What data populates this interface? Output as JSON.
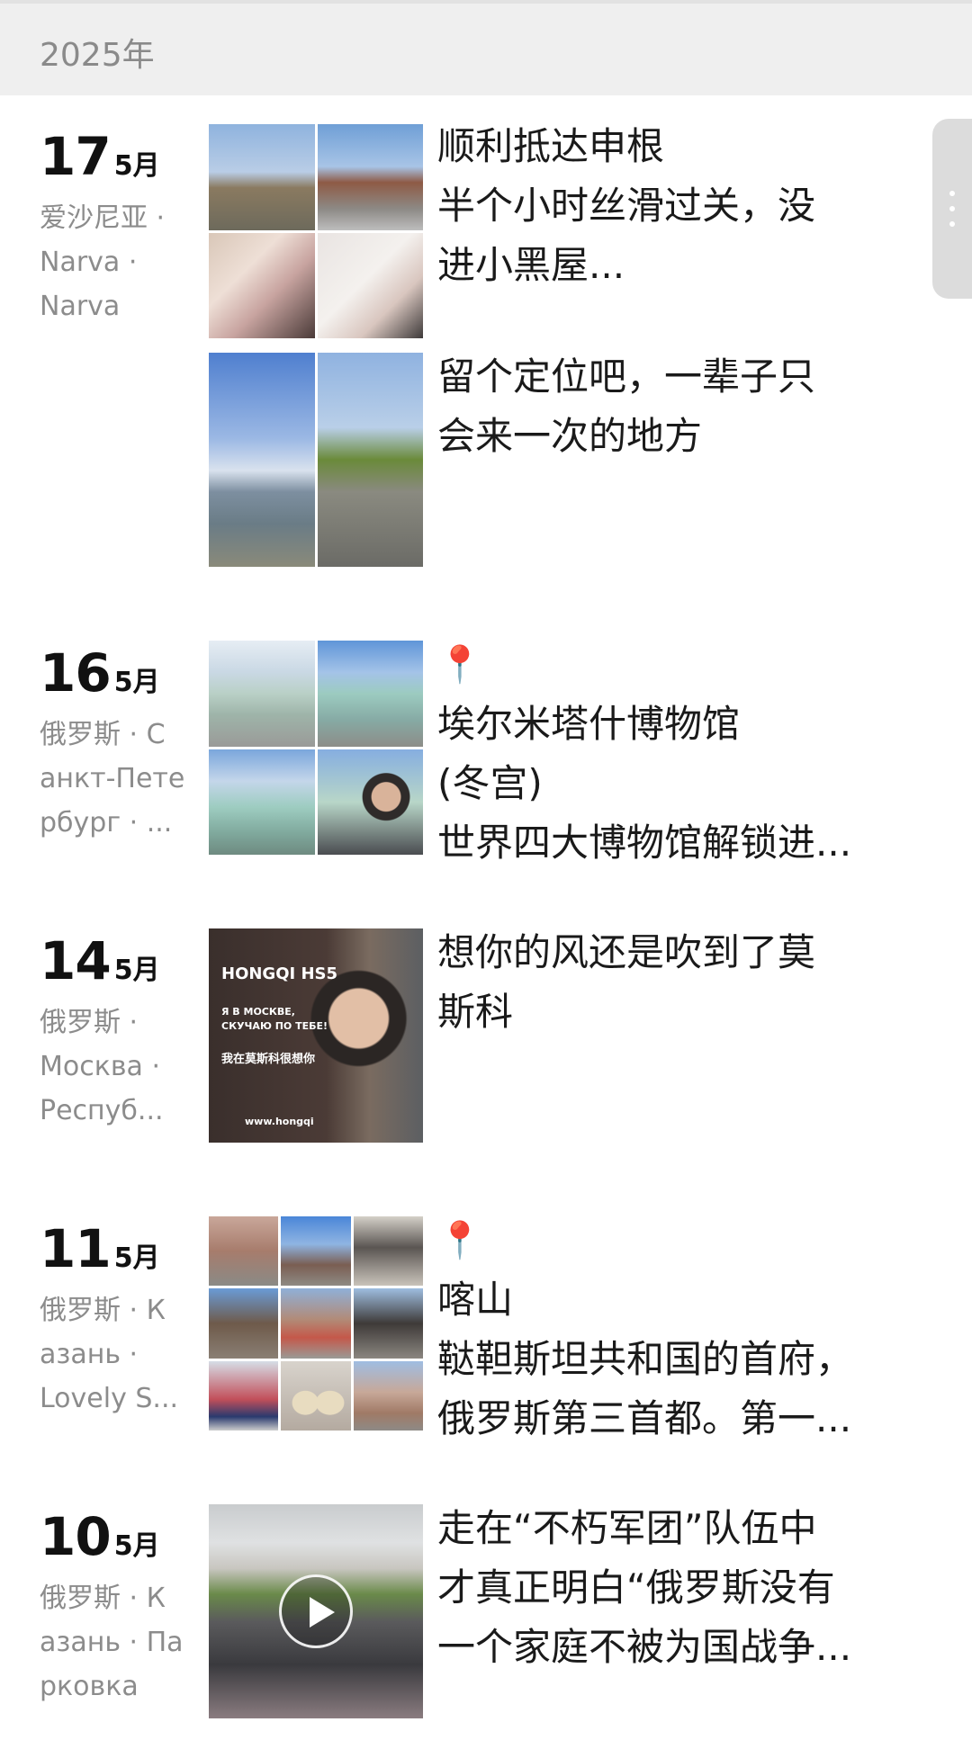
{
  "year_header": "2025年",
  "entries": [
    {
      "day": "17",
      "month": "5月",
      "location_lines": [
        "爱沙尼亚 ·",
        "Narva ·",
        "Narva"
      ],
      "posts": [
        {
          "caption_lines": [
            "顺利抵达申根",
            "半个小时丝滑过关，没",
            "进小黑屋..."
          ],
          "pin": false
        },
        {
          "caption_lines": [
            "留个定位吧，一辈子只",
            "会来一次的地方"
          ],
          "pin": false
        }
      ]
    },
    {
      "day": "16",
      "month": "5月",
      "location_lines": [
        "俄罗斯 · С",
        "анкт-Пете",
        "рбург · ..."
      ],
      "posts": [
        {
          "caption_lines": [
            "埃尔米塔什博物馆",
            "(冬宫)",
            "世界四大博物馆解锁进..."
          ],
          "pin": true
        }
      ]
    },
    {
      "day": "14",
      "month": "5月",
      "location_lines": [
        "俄罗斯 ·",
        "Москва ·",
        "Респуб..."
      ],
      "posts": [
        {
          "caption_lines": [
            "想你的风还是吹到了莫",
            "斯科"
          ],
          "pin": false,
          "photo_text": [
            "HONGQI HS5",
            "Я В МОСКВЕ,",
            "СКУЧАЮ ПО ТЕБЕ!",
            "我在莫斯科很想你",
            "www.hongqi"
          ]
        }
      ]
    },
    {
      "day": "11",
      "month": "5月",
      "location_lines": [
        "俄罗斯 · К",
        "азань ·",
        "Lovely S..."
      ],
      "posts": [
        {
          "caption_lines": [
            "喀山",
            "鞑靼斯坦共和国的首府，",
            "俄罗斯第三首都。第一..."
          ],
          "pin": true
        }
      ]
    },
    {
      "day": "10",
      "month": "5月",
      "location_lines": [
        "俄罗斯 · К",
        "азань · Па",
        "рковка"
      ],
      "posts": [
        {
          "caption_lines": [
            "走在“不朽军团”队伍中",
            "才真正明白“俄罗斯没有",
            "一个家庭不被为国战争..."
          ],
          "pin": false,
          "video": true
        }
      ]
    }
  ],
  "icons": {
    "pin": "location-pin-icon",
    "play": "play-icon",
    "handle": "more-vertical-icon"
  },
  "colors": {
    "header_bg": "#efefef",
    "muted_text": "#8c8c8c",
    "pin_red": "#e03a3a"
  }
}
